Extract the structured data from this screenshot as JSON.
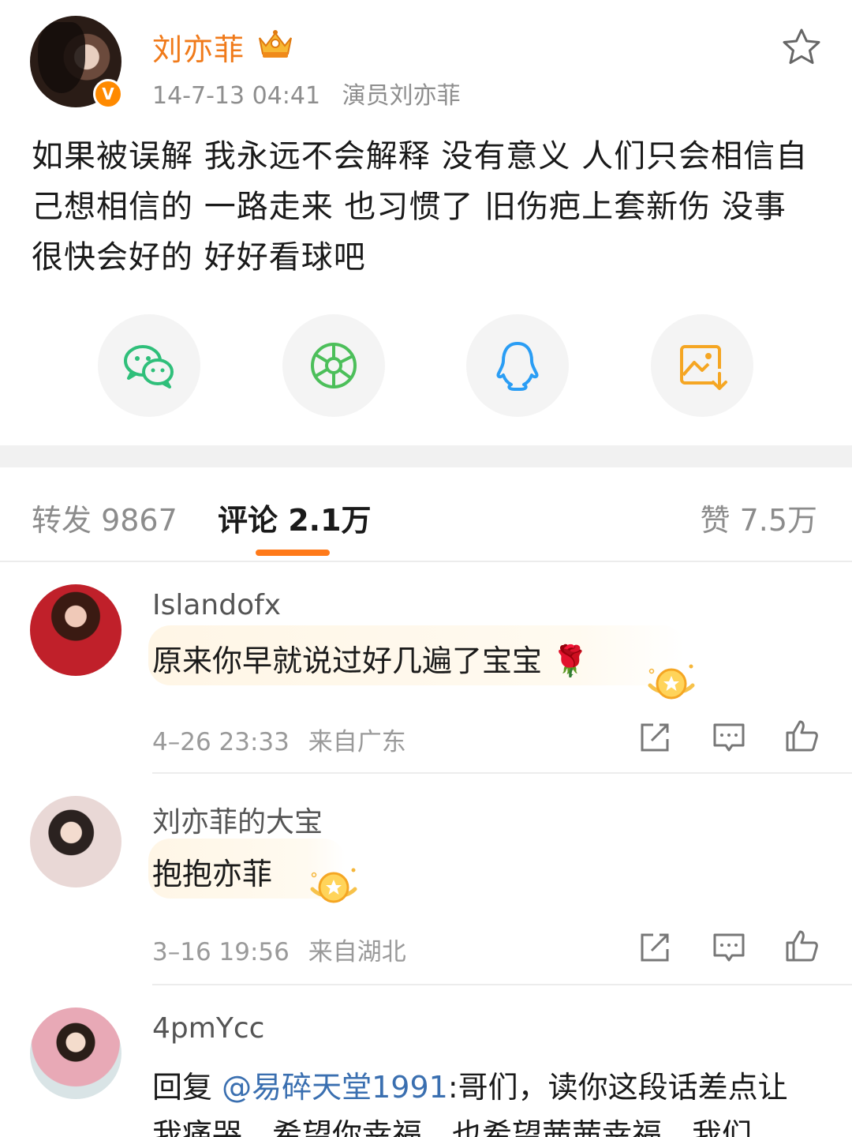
{
  "post": {
    "username": "刘亦菲",
    "verified_badge": "V",
    "date": "14-7-13 04:41",
    "source": "演员刘亦菲",
    "text": "如果被误解 我永远不会解释 没有意义 人们只会相信自己想相信的 一路走来 也习惯了 旧伤疤上套新伤 没事 很快会好的 好好看球吧",
    "share_targets": [
      "wechat-icon",
      "moments-icon",
      "qq-icon",
      "save-image-icon"
    ]
  },
  "tabs": {
    "reposts": "转发 9867",
    "comments": "评论 2.1万",
    "likes": "赞 7.5万"
  },
  "comments": [
    {
      "name": "Islandofx",
      "text": "原来你早就说过好几遍了宝宝 🌹",
      "time": "4–26 23:33",
      "location": "来自广东"
    },
    {
      "name": "刘亦菲的大宝",
      "text": "抱抱亦菲",
      "time": "3–16 19:56",
      "location": "来自湖北"
    },
    {
      "name": "4pmYcc",
      "reply_prefix": "回复 ",
      "mention": "@易碎天堂1991",
      "text": ":哥们，读你这段话差点让",
      "text_line2": "我痛哭，希望你幸福，也希望茜茜幸福。我们"
    }
  ],
  "colors": {
    "accent": "#ff7a1a",
    "username": "#f07a1a",
    "mention": "#3a6fb0",
    "wechat": "#2fbf7a",
    "moments": "#4cbf5a",
    "qq": "#2a9df4",
    "save": "#f5a623"
  }
}
